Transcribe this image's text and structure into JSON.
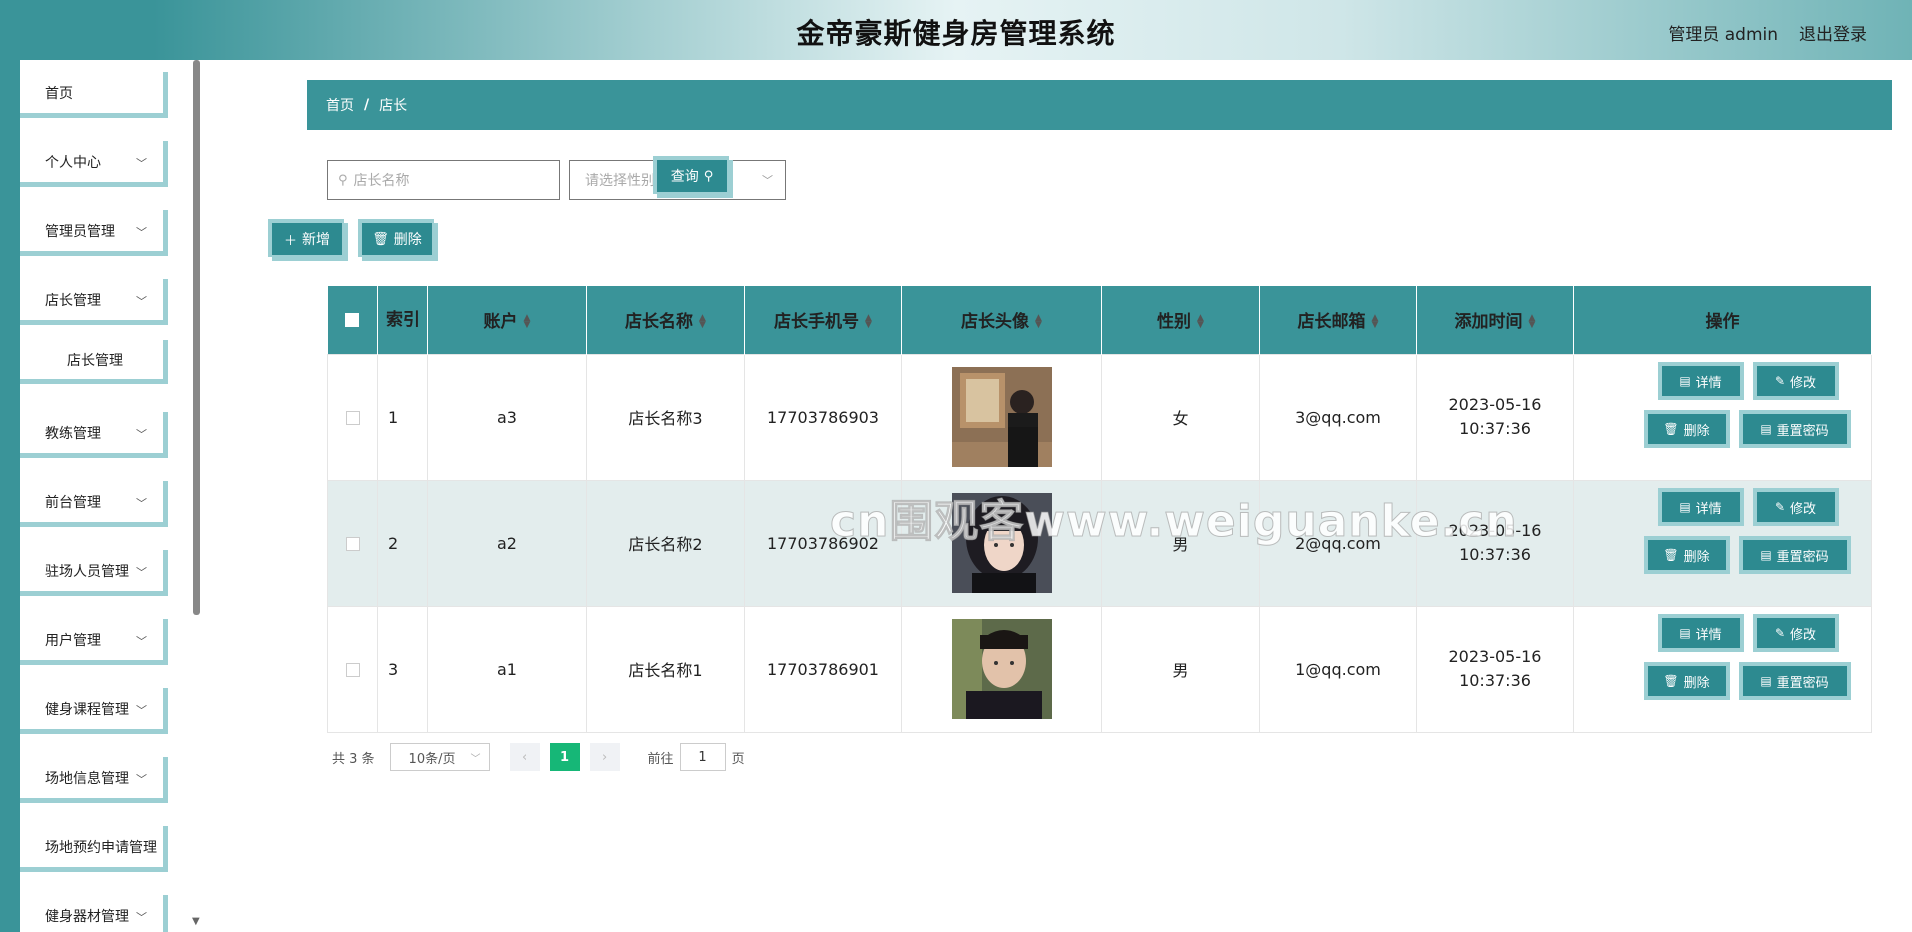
{
  "header": {
    "title": "金帝豪斯健身房管理系统",
    "admin": "管理员 admin",
    "logout": "退出登录"
  },
  "sidebar": {
    "items": [
      {
        "label": "首页"
      },
      {
        "label": "个人中心"
      },
      {
        "label": "管理员管理"
      },
      {
        "label": "店长管理"
      },
      {
        "label": "店长管理"
      },
      {
        "label": "教练管理"
      },
      {
        "label": "前台管理"
      },
      {
        "label": "驻场人员管理"
      },
      {
        "label": "用户管理"
      },
      {
        "label": "健身课程管理"
      },
      {
        "label": "场地信息管理"
      },
      {
        "label": "场地预约申请管理"
      },
      {
        "label": "健身器材管理"
      }
    ]
  },
  "breadcrumb": {
    "home": "首页",
    "sep": "/",
    "current": "店长"
  },
  "search": {
    "name_placeholder": "店长名称",
    "gender_placeholder": "请选择性别",
    "query_label": "查询"
  },
  "actions": {
    "add_label": "新增",
    "delete_label": "删除"
  },
  "table": {
    "headers": [
      "索引",
      "账户",
      "店长名称",
      "店长手机号",
      "店长头像",
      "性别",
      "店长邮箱",
      "添加时间",
      "操作"
    ],
    "rows": [
      {
        "index": "1",
        "account": "a3",
        "name": "店长名称3",
        "phone": "17703786903",
        "gender": "女",
        "email": "3@qq.com",
        "time": "2023-05-16 10:37:36"
      },
      {
        "index": "2",
        "account": "a2",
        "name": "店长名称2",
        "phone": "17703786902",
        "gender": "男",
        "email": "2@qq.com",
        "time": "2023-05-16 10:37:36"
      },
      {
        "index": "3",
        "account": "a1",
        "name": "店长名称1",
        "phone": "17703786901",
        "gender": "男",
        "email": "1@qq.com",
        "time": "2023-05-16 10:37:36"
      }
    ],
    "ops": {
      "detail": "详情",
      "edit": "修改",
      "delete": "删除",
      "reset": "重置密码"
    }
  },
  "pager": {
    "total": "共 3 条",
    "size": "10条/页",
    "current": "1",
    "goto_prefix": "前往",
    "goto_value": "1",
    "goto_suffix": "页"
  },
  "watermark": "cn围观客www.weiguanke.cn",
  "colors": {
    "accent": "#3a9499",
    "accent_light": "#9ccfd3",
    "page_active": "#16b777"
  }
}
